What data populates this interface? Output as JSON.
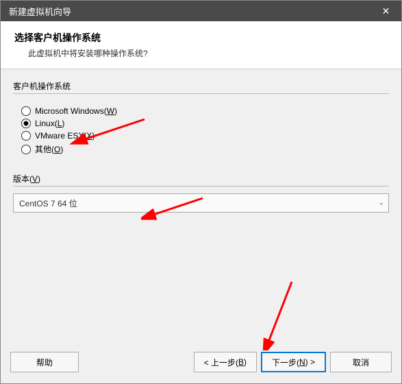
{
  "titlebar": {
    "title": "新建虚拟机向导"
  },
  "header": {
    "title": "选择客户机操作系统",
    "description": "此虚拟机中将安装哪种操作系统?"
  },
  "os_group": {
    "label": "客户机操作系统",
    "options": {
      "windows": {
        "text": "Microsoft Windows(",
        "key": "W",
        "suffix": ")"
      },
      "linux": {
        "text": "Linux(",
        "key": "L",
        "suffix": ")"
      },
      "vmware": {
        "text": "VMware ESX(",
        "key": "X",
        "suffix": ")"
      },
      "other": {
        "text": "其他(",
        "key": "O",
        "suffix": ")"
      }
    }
  },
  "version": {
    "label_prefix": "版本(",
    "label_key": "V",
    "label_suffix": ")",
    "selected": "CentOS 7 64 位"
  },
  "footer": {
    "help": "帮助",
    "back_prefix": "< 上一步(",
    "back_key": "B",
    "back_suffix": ")",
    "next_prefix": "下一步(",
    "next_key": "N",
    "next_suffix": ") >",
    "cancel": "取消"
  }
}
